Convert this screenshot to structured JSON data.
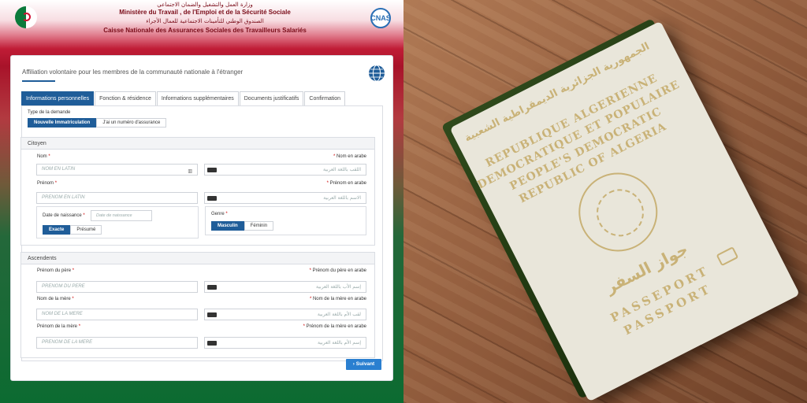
{
  "header": {
    "ministry_ar": "وزارة العمل والتشغيل والضمان الاجتماعي",
    "ministry_fr": "Ministère du Travail , de l'Emploi et de la Sécurité Sociale",
    "fund_ar": "الصندوق الوطني للتأمينات الاجتماعية للعمال الأجراء",
    "fund_fr": "Caisse Nationale des Assurances Sociales des Travailleurs Salariés",
    "logo_text": "CNAS"
  },
  "form": {
    "title": "Affiliation volontaire pour les membres de la communauté nationale à l'étranger",
    "tabs": [
      {
        "label": "Informations personnelles",
        "active": true
      },
      {
        "label": "Fonction & résidence",
        "active": false
      },
      {
        "label": "Informations supplémentaires",
        "active": false
      },
      {
        "label": "Documents justificatifs",
        "active": false
      },
      {
        "label": "Confirmation",
        "active": false
      }
    ],
    "request_type": {
      "label": "Type de la demande",
      "options": [
        "Nouvelle Immatriculation",
        "J'ai un numéro d'assurance"
      ],
      "selected": "Nouvelle Immatriculation"
    },
    "citoyen": {
      "heading": "Citoyen",
      "nom_label": "Nom",
      "nom_placeholder": "NOM EN LATIN",
      "nom_ar_label": "Nom en arabe",
      "nom_ar_placeholder": "اللقب باللغة العربية",
      "prenom_label": "Prénom",
      "prenom_placeholder": "PRENOM EN LATIN",
      "prenom_ar_label": "Prénom en arabe",
      "prenom_ar_placeholder": "الاسم باللغة العربية",
      "birth_label": "Date de naissance",
      "birth_placeholder": "Date de naissance",
      "birth_options": [
        "Exacte",
        "Présumé"
      ],
      "birth_selected": "Exacte",
      "genre_label": "Genre",
      "genre_options": [
        "Masculin",
        "Féminin"
      ],
      "genre_selected": "Masculin"
    },
    "ascendents": {
      "heading": "Ascendents",
      "father_label": "Prénom du père",
      "father_placeholder": "PRENOM DU PERE",
      "father_ar_label": "Prénom du père en arabe",
      "father_ar_placeholder": "إسم الأب باللغة العربية",
      "mother_label": "Nom de la mère",
      "mother_placeholder": "NOM DE LA MERE",
      "mother_ar_label": "Nom de la mère en arabe",
      "mother_ar_placeholder": "لقب الأم باللغة العربية",
      "mother_first_label": "Prénom de la mère",
      "mother_first_placeholder": "PRENOM DE LA MERE",
      "mother_first_ar_label": "Prénom de la mère en arabe",
      "mother_first_ar_placeholder": "إسم الأم باللغة العربية"
    },
    "required_mark": "*",
    "next_button": "Suivant",
    "next_icon": "›"
  },
  "passport": {
    "arabic_top": "الجمهورية الجزائرية الديمقراطية الشعبية",
    "line1": "REPUBLIQUE ALGERIENNE",
    "line2": "DEMOCRATIQUE ET POPULAIRE",
    "line3": "PEOPLE'S DEMOCRATIC",
    "line4": "REPUBLIC OF ALGERIA",
    "arabic_passport": "جواز السفر",
    "passport1": "PASSEPORT",
    "passport2": "PASSPORT"
  },
  "colors": {
    "primary": "#1f5d99",
    "button": "#2a7fd0",
    "passport_green": "#223a12",
    "gold": "#c9b277"
  }
}
